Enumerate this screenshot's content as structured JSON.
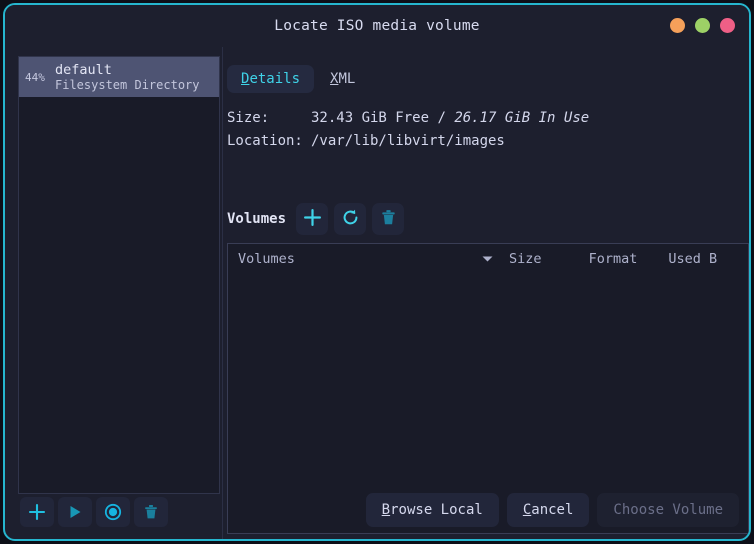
{
  "window": {
    "title": "Locate ISO media volume",
    "border_color": "#26b6cf",
    "controls": [
      {
        "name": "minimize",
        "color": "#f5a05a"
      },
      {
        "name": "maximize",
        "color": "#9dd166"
      },
      {
        "name": "close",
        "color": "#ef5f86"
      }
    ]
  },
  "sidebar": {
    "pools": [
      {
        "percent": "44%",
        "name": "default",
        "type": "Filesystem Directory",
        "selected": true
      }
    ],
    "toolbar": [
      {
        "icon": "plus-icon",
        "label": "Add Pool"
      },
      {
        "icon": "play-icon",
        "label": "Start Pool"
      },
      {
        "icon": "stop-icon",
        "label": "Stop Pool"
      },
      {
        "icon": "trash-icon",
        "label": "Delete Pool"
      }
    ]
  },
  "content": {
    "tabs": [
      {
        "label": "Details",
        "mnemonic": "D",
        "rest": "etails",
        "active": true
      },
      {
        "label": "XML",
        "mnemonic": "X",
        "rest": "ML",
        "active": false
      }
    ],
    "details": {
      "size_label": "Size:",
      "size_free": "32.43 GiB Free",
      "size_separator": " / ",
      "size_in_use": "26.17 GiB In Use",
      "location_label": "Location:",
      "location_value": "/var/lib/libvirt/images"
    },
    "volumes": {
      "section_label": "Volumes",
      "toolbar": [
        {
          "icon": "plus-icon",
          "label": "Create Volume"
        },
        {
          "icon": "refresh-icon",
          "label": "Refresh Volumes"
        },
        {
          "icon": "trash-icon",
          "label": "Delete Volume"
        }
      ],
      "columns": [
        {
          "key": "volumes",
          "label": "Volumes",
          "sorted": true,
          "sort_dir": "desc"
        },
        {
          "key": "size",
          "label": "Size"
        },
        {
          "key": "format",
          "label": "Format"
        },
        {
          "key": "used_by",
          "label": "Used B"
        }
      ],
      "rows": []
    }
  },
  "actions": [
    {
      "id": "browse-local",
      "mnemonic": "B",
      "rest": "rowse Local",
      "disabled": false
    },
    {
      "id": "cancel",
      "mnemonic": "C",
      "rest": "ancel",
      "disabled": false
    },
    {
      "id": "choose-volume",
      "label": "Choose Volume",
      "disabled": true
    }
  ],
  "colors": {
    "accent": "#3fd3e8",
    "selection": "#4e5473",
    "window_bg": "#1d1f2e",
    "panel_bg": "#191b28"
  }
}
